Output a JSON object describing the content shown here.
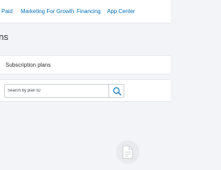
{
  "top_nav": {
    "items": [
      {
        "label": "Paid"
      },
      {
        "label": "Marketing For Growth"
      },
      {
        "label": "Financing"
      },
      {
        "label": "App Center"
      }
    ]
  },
  "page": {
    "title": "ons"
  },
  "tabs": {
    "active_label": "Subscription plans"
  },
  "search": {
    "placeholder": "Search by plan ID",
    "value": "",
    "button_icon": "magnifier-icon"
  },
  "empty_state": {
    "icon": "document-icon"
  },
  "colors": {
    "link": "#0070ba",
    "background": "#f2f4f7",
    "panel": "#ffffff",
    "text": "#2c2e2f"
  }
}
